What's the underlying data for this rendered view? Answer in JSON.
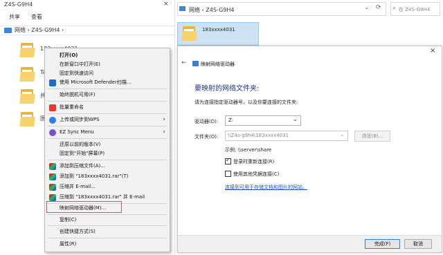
{
  "left_explorer": {
    "title": "Z4S-G9H4",
    "close_glyph": "×",
    "ribbon_tabs": [
      "共享",
      "查看"
    ],
    "breadcrumb": "网络  ›  Z4S-G9H4  ›",
    "folders_peek": [
      "183xxxx4031",
      "Ta",
      "共",
      "国"
    ]
  },
  "context_menu": {
    "items": [
      {
        "label": "打开(O)",
        "icon": ""
      },
      {
        "label": "在新窗口中打开(E)",
        "icon": ""
      },
      {
        "label": "固定到快速访问",
        "icon": ""
      },
      {
        "label": "使用 Microsoft Defender扫描...",
        "icon": "defender-shield-icon"
      },
      {
        "label": "始终脱机可用(F)",
        "icon": ""
      },
      {
        "label": "批量重命名",
        "icon": "wps-icon"
      },
      {
        "label": "上传或同步到WPS",
        "icon": "wps-cloud-icon"
      },
      {
        "label": "EZ Sync Menu",
        "icon": "ez-sync-icon"
      },
      {
        "label": "还原以前的版本(V)",
        "icon": ""
      },
      {
        "label": "固定到\"开始\"屏幕(P)",
        "icon": ""
      },
      {
        "label": "添加到压缩文件(A)...",
        "icon": "winrar-icon"
      },
      {
        "label": "添加到 \"183xxxx4031.rar\"(T)",
        "icon": "winrar-icon"
      },
      {
        "label": "压缩并 E-mail...",
        "icon": "winrar-icon"
      },
      {
        "label": "压缩到 \"183xxxx4031.rar\" 并 E-mail",
        "icon": "winrar-icon"
      },
      {
        "label": "映射网络驱动器(M)...",
        "icon": ""
      },
      {
        "label": "复制(C)",
        "icon": ""
      },
      {
        "label": "创建快捷方式(S)",
        "icon": ""
      },
      {
        "label": "属性(R)",
        "icon": ""
      }
    ],
    "arrow_glyph": "›"
  },
  "right_explorer": {
    "breadcrumb": "网络  ›  Z4S-G9H4",
    "dropdown_glyph": "⌄",
    "refresh_glyph": "⟳",
    "search_icon_glyph": "⌕",
    "search_placeholder": "在 Z4S-G9H4",
    "selected_folder": "183xxxx4031"
  },
  "dialog": {
    "close_glyph": "×",
    "back_glyph": "←",
    "title": "映射网络驱动器",
    "heading": "要映射的网络文件夹:",
    "description": "请为连接指定驱动器号，以及你要连接的文件夹:",
    "drive_label": "驱动器(D):",
    "drive_value": "Z:",
    "folder_label": "文件夹(O):",
    "folder_value": "\\\\Z4s-g9h4\\183xxxx4031",
    "browse_label": "浏览(B)...",
    "example": "示例: \\\\server\\share",
    "reconnect_label": "登录时重新连接(R)",
    "reconnect_checked": true,
    "other_credentials_label": "使用其他凭据连接(C)",
    "other_credentials_checked": false,
    "link_text": "连接到可用于存储文档和图片的网站。",
    "finish_label": "完成(F)",
    "cancel_label": "取消",
    "check_glyph": "✓",
    "chevron_glyph": "⌄"
  },
  "colors": {
    "accent_blue": "#2f7fd9",
    "heading_blue": "#1e3287",
    "highlight_red": "#d9534f",
    "selection_blue": "#cde3f5"
  }
}
